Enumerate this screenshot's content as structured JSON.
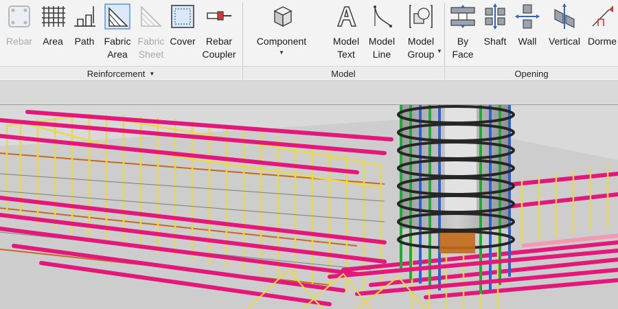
{
  "ribbon": {
    "panels": {
      "reinforcement": {
        "title": "Reinforcement",
        "tools": {
          "rebar": {
            "line1": "Rebar",
            "icon": "rebar-icon",
            "enabled": false
          },
          "area": {
            "line1": "Area",
            "icon": "area-grid-icon"
          },
          "path": {
            "line1": "Path",
            "icon": "path-icon"
          },
          "fabric_area": {
            "line1": "Fabric",
            "line2": "Area",
            "icon": "fabric-area-icon"
          },
          "fabric_sheet": {
            "line1": "Fabric",
            "line2": "Sheet",
            "icon": "fabric-sheet-icon",
            "enabled": false
          },
          "cover": {
            "line1": "Cover",
            "icon": "cover-icon"
          },
          "rebar_coupler": {
            "line1": "Rebar",
            "line2": "Coupler",
            "icon": "coupler-icon"
          }
        }
      },
      "model": {
        "title": "Model",
        "tools": {
          "component": {
            "line1": "Component",
            "icon": "component-cube-icon"
          },
          "model_text": {
            "line1": "Model",
            "line2": "Text",
            "icon": "model-text-icon"
          },
          "model_line": {
            "line1": "Model",
            "line2": "Line",
            "icon": "model-line-icon"
          },
          "model_group": {
            "line1": "Model",
            "line2": "Group",
            "icon": "model-group-icon"
          }
        }
      },
      "opening": {
        "title": "Opening",
        "tools": {
          "by_face": {
            "line1": "By",
            "line2": "Face",
            "icon": "by-face-icon"
          },
          "shaft": {
            "line1": "Shaft",
            "icon": "shaft-icon"
          },
          "wall": {
            "line1": "Wall",
            "icon": "wall-opening-icon"
          },
          "vertical": {
            "line1": "Vertical",
            "icon": "vertical-opening-icon"
          },
          "dormer": {
            "line1": "Dorme",
            "icon": "dormer-icon"
          }
        }
      }
    }
  },
  "colors": {
    "ribbon_bg": "#f3f3f3",
    "stirrup_yellow": "#e8d84a",
    "main_bar_magenta": "#e0197a",
    "column_green": "#23a83a",
    "column_blue": "#2b62d6",
    "column_ties": "#262626",
    "concrete": "#b9b9b9"
  }
}
